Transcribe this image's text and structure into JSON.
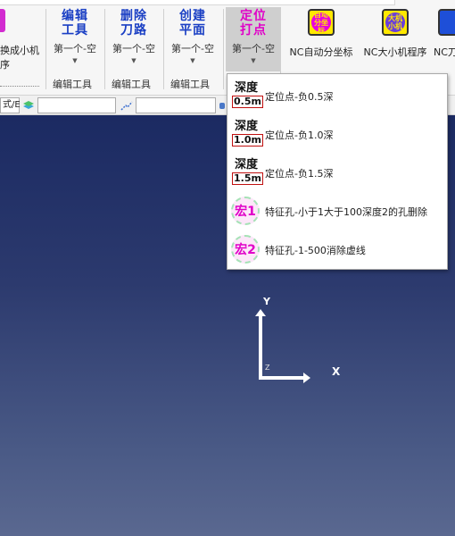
{
  "ribbon": {
    "left_partial": {
      "line1": "换成小机",
      "line2": "序"
    },
    "buttons": [
      {
        "title": "编辑\n工具",
        "sub": "第一个-空"
      },
      {
        "title": "删除\n刀路",
        "sub": "第一个-空"
      },
      {
        "title": "创建\n平面",
        "sub": "第一个-空"
      },
      {
        "title": "定位\n打点",
        "sub": "第一个-空"
      }
    ],
    "group_labels": [
      "编辑工具",
      "编辑工具",
      "编辑工具"
    ],
    "nc_items": [
      {
        "icon_text": "自动\n分坐标",
        "label": "NC自动分坐标"
      },
      {
        "icon_text": "大机\n小机",
        "label": "NC大小机程序"
      },
      {
        "icon_text": "",
        "label": "NC刀"
      }
    ]
  },
  "toolbar": {
    "combo1": "式/E",
    "combo2": "",
    "combo3": ""
  },
  "dropdown": {
    "items": [
      {
        "icon": "depth",
        "top": "深度",
        "box": "0.5m",
        "label": "定位点-负0.5深"
      },
      {
        "icon": "depth",
        "top": "深度",
        "box": "1.0m",
        "label": "定位点-负1.0深"
      },
      {
        "icon": "depth",
        "top": "深度",
        "box": "1.5m",
        "label": "定位点-负1.5深"
      },
      {
        "icon": "macro",
        "macro": "宏1",
        "label": "特征孔-小于1大于100深度2的孔删除"
      },
      {
        "icon": "macro",
        "macro": "宏2",
        "label": "特征孔-1-500消除虚线"
      }
    ]
  },
  "viewport": {
    "axis_x": "X",
    "axis_y": "Y",
    "axis_z": "Z"
  },
  "colors": {
    "accent_blue": "#1a3fc4",
    "accent_magenta": "#e000c8",
    "viewport_top": "#1b2a62",
    "viewport_bottom": "#5a6890"
  }
}
